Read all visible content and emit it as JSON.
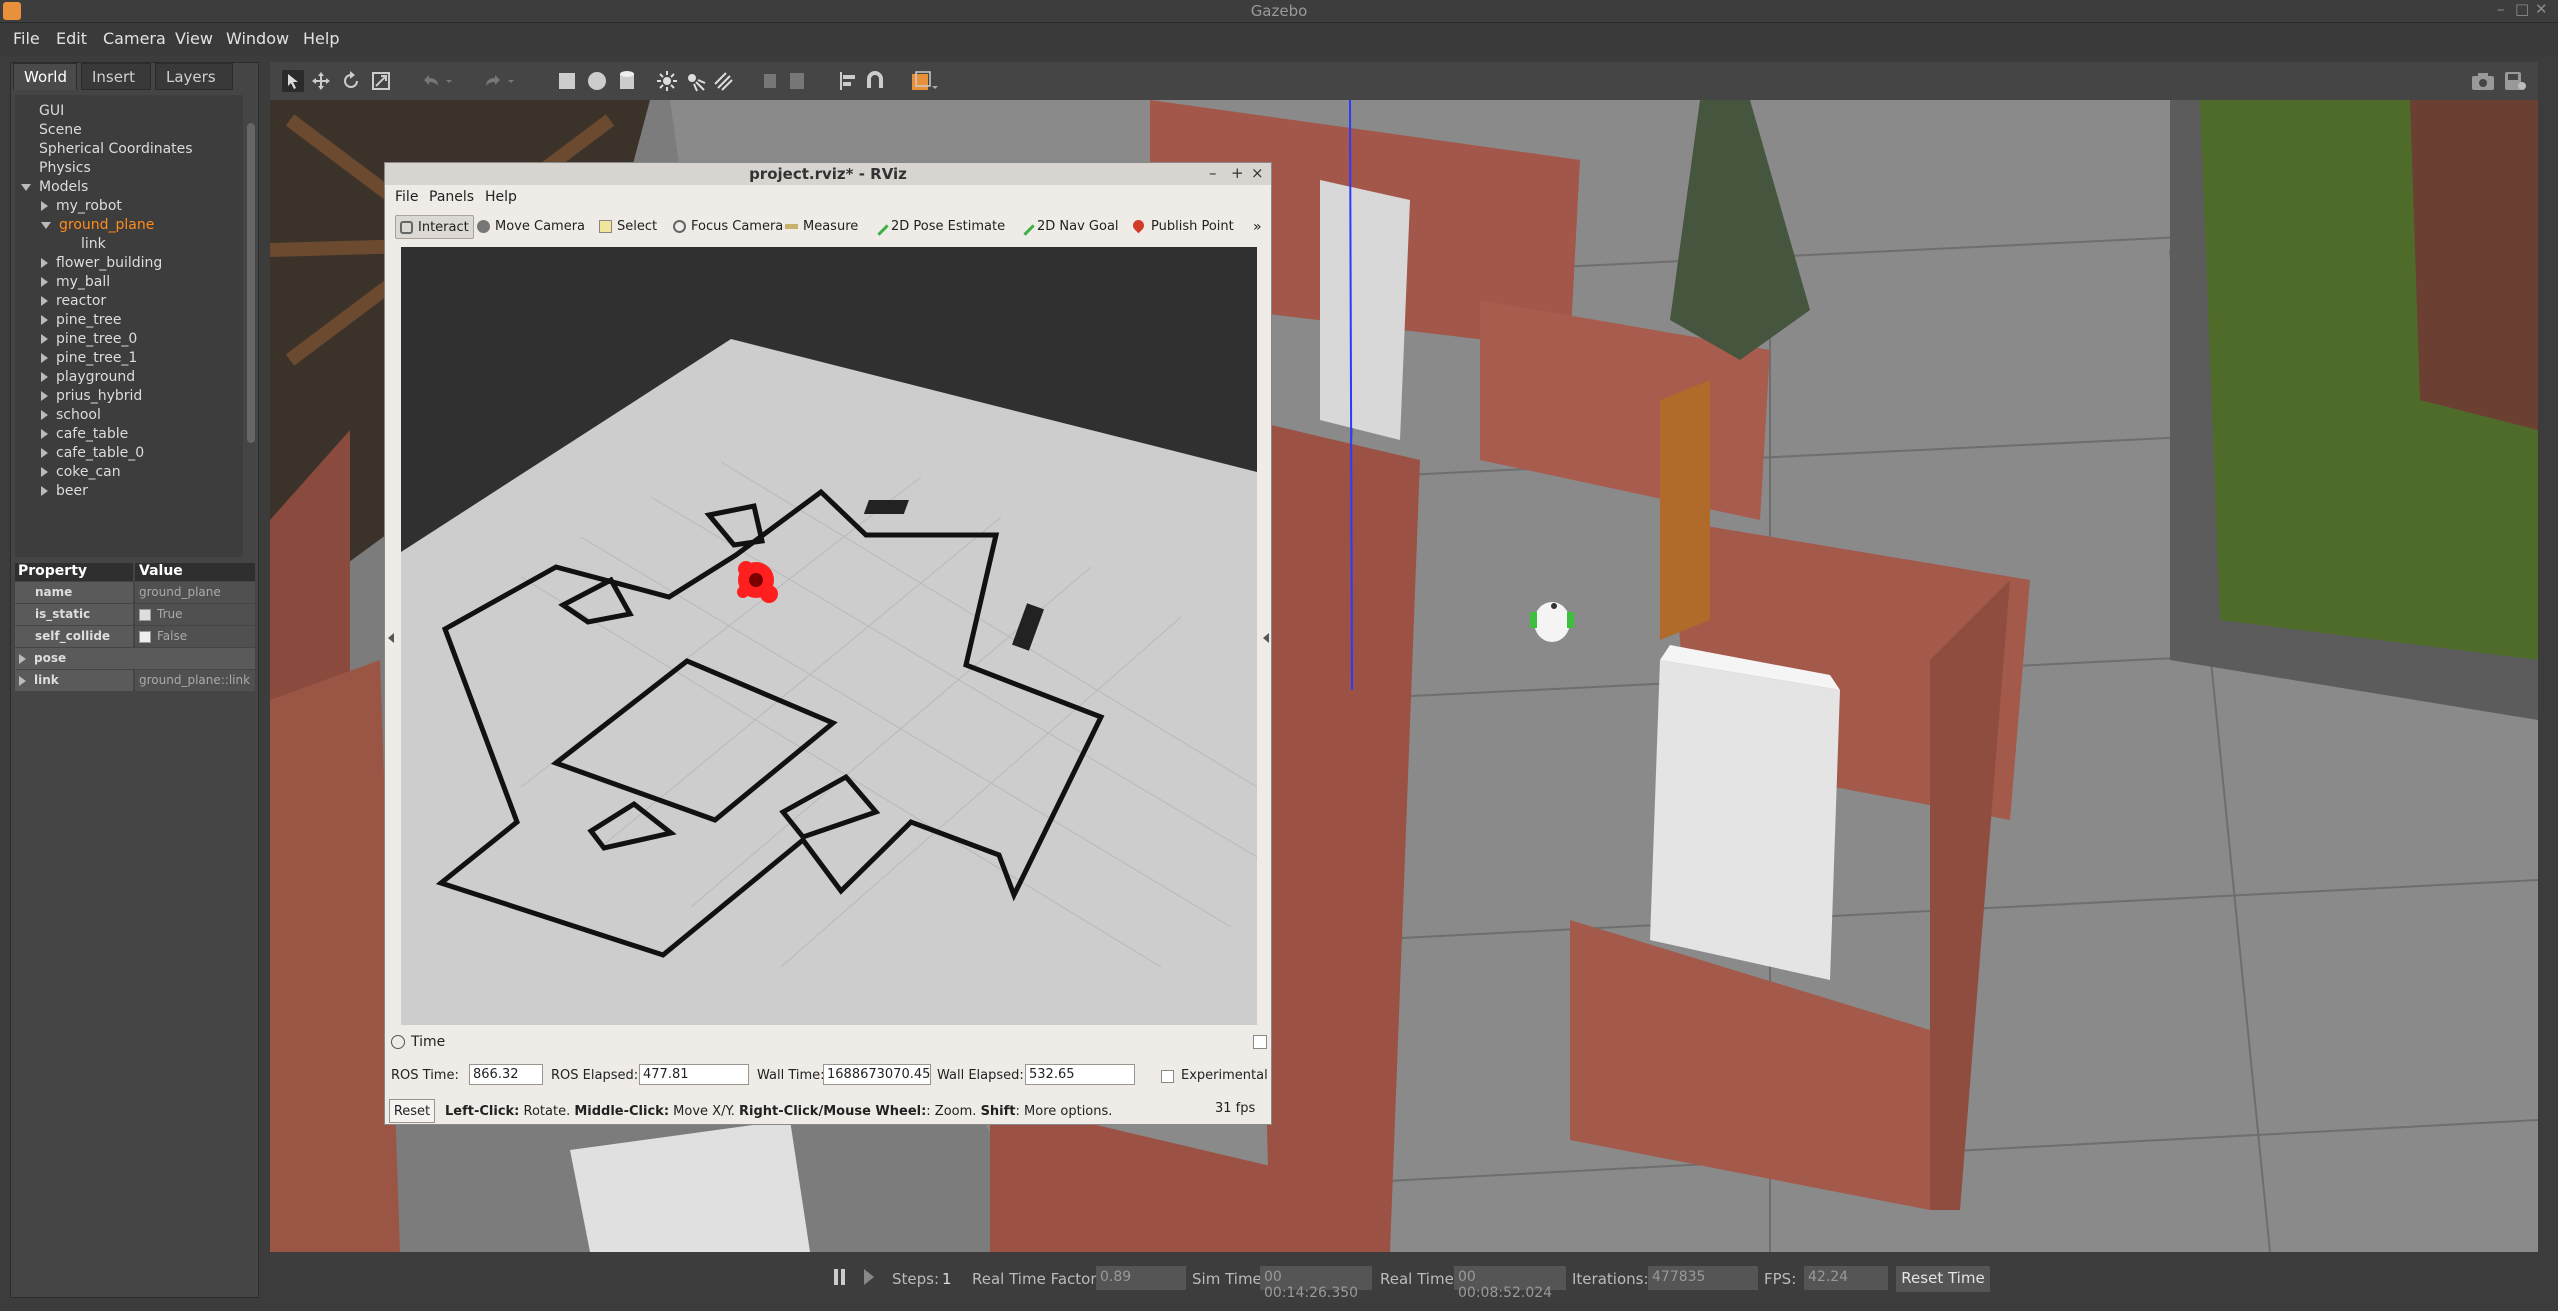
{
  "window": {
    "title": "Gazebo",
    "controls": [
      "–",
      "□",
      "✕"
    ]
  },
  "menu": [
    "File",
    "Edit",
    "Camera",
    "View",
    "Window",
    "Help"
  ],
  "left_tabs": [
    "World",
    "Insert",
    "Layers"
  ],
  "tree": {
    "top": [
      "GUI",
      "Scene",
      "Spherical Coordinates",
      "Physics"
    ],
    "models_label": "Models",
    "models": [
      "my_robot",
      "ground_plane",
      "link",
      "flower_building",
      "my_ball",
      "reactor",
      "pine_tree",
      "pine_tree_0",
      "pine_tree_1",
      "playground",
      "prius_hybrid",
      "school",
      "cafe_table",
      "cafe_table_0",
      "coke_can",
      "beer"
    ]
  },
  "properties": {
    "header": [
      "Property",
      "Value"
    ],
    "rows": [
      {
        "name": "name",
        "value": "ground_plane"
      },
      {
        "name": "is_static",
        "value": "True"
      },
      {
        "name": "self_collide",
        "value": "False"
      },
      {
        "name": "pose",
        "value": ""
      },
      {
        "name": "link",
        "value": "ground_plane::link"
      }
    ]
  },
  "bottom": {
    "steps_label": "Steps:",
    "steps": "1",
    "rtf_label": "Real Time Factor:",
    "rtf": "0.89",
    "sim_label": "Sim Time:",
    "sim": "00 00:14:26.350",
    "real_label": "Real Time:",
    "real": "00 00:08:52.024",
    "iter_label": "Iterations:",
    "iter": "477835",
    "fps_label": "FPS:",
    "fps": "42.24",
    "reset": "Reset Time"
  },
  "rviz": {
    "title": "project.rviz* - RViz",
    "menu": [
      "File",
      "Panels",
      "Help"
    ],
    "tools": [
      "Interact",
      "Move Camera",
      "Select",
      "Focus Camera",
      "Measure",
      "2D Pose Estimate",
      "2D Nav Goal",
      "Publish Point"
    ],
    "more": "»",
    "time_panel": "Time",
    "ros_time_label": "ROS Time:",
    "ros_time": "866.32",
    "ros_elapsed_label": "ROS Elapsed:",
    "ros_elapsed": "477.81",
    "wall_time_label": "Wall Time:",
    "wall_time": "1688673070.45",
    "wall_elapsed_label": "Wall Elapsed:",
    "wall_elapsed": "532.65",
    "experimental": "Experimental",
    "reset": "Reset",
    "hint_lc": "Left-Click:",
    "hint_lc_t": " Rotate. ",
    "hint_mc": "Middle-Click:",
    "hint_mc_t": " Move X/Y. ",
    "hint_rc": "Right-Click/Mouse Wheel:",
    "hint_rc_t": ": Zoom. ",
    "hint_sh": "Shift",
    "hint_sh_t": ": More options.",
    "fps": "31 fps"
  }
}
